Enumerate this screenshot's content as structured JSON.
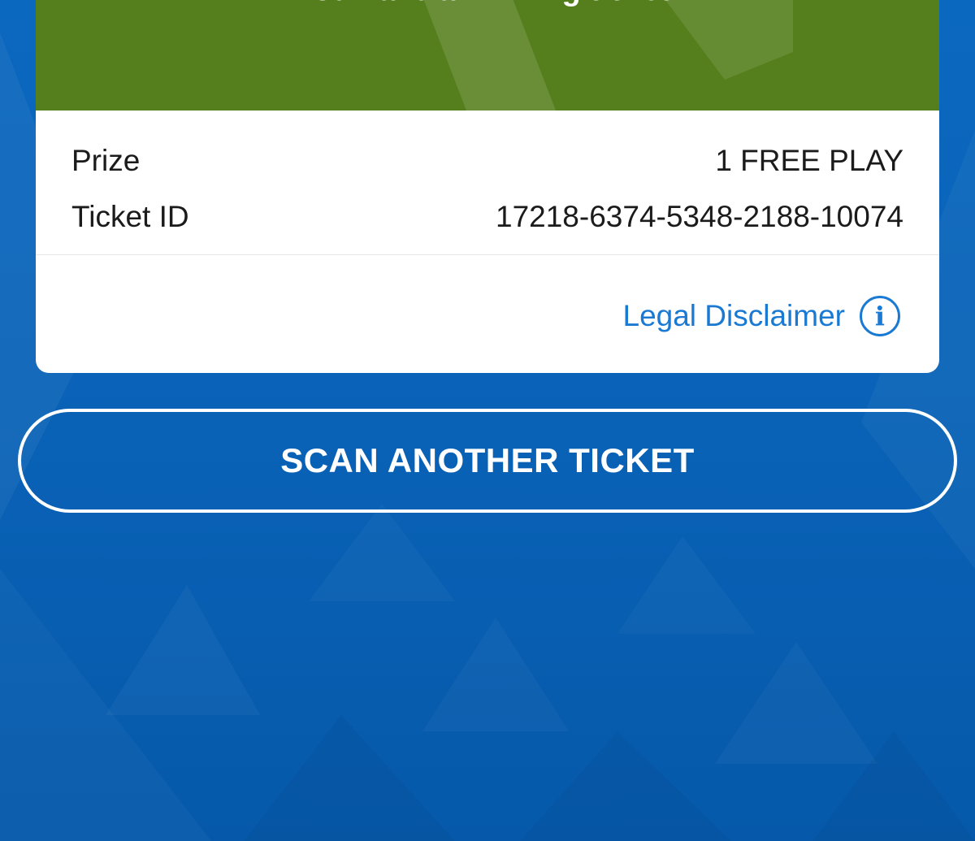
{
  "banner": {
    "title": "You have a winning ticket!",
    "color": "#557f1c"
  },
  "details": {
    "prize_label": "Prize",
    "prize_value": "1 FREE PLAY",
    "ticket_id_label": "Ticket ID",
    "ticket_id_value": "17218-6374-5348-2188-10074"
  },
  "disclaimer": {
    "label": "Legal Disclaimer",
    "icon": "info-icon",
    "icon_glyph": "i",
    "color": "#1a7ad3"
  },
  "actions": {
    "scan_another_label": "SCAN ANOTHER TICKET"
  },
  "theme": {
    "background": "#0a63b8",
    "card": "#ffffff"
  }
}
